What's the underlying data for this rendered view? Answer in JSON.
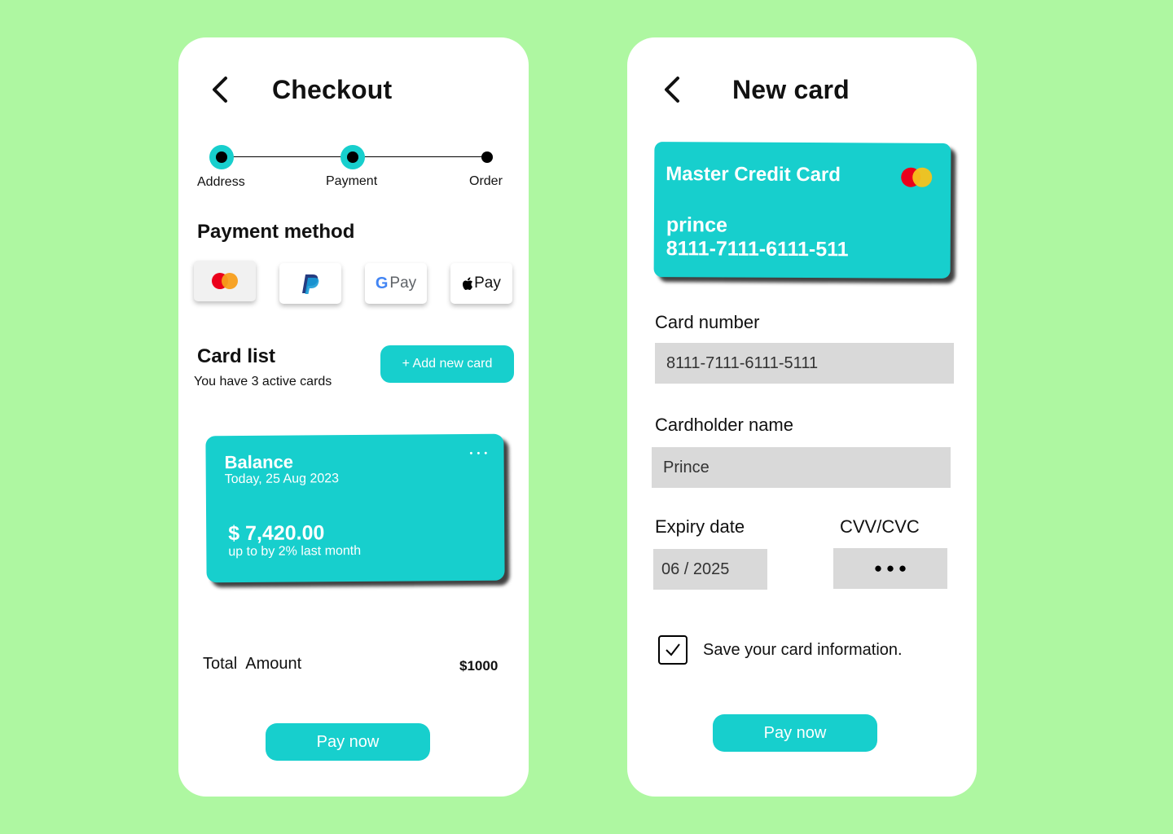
{
  "checkout": {
    "title": "Checkout",
    "steps": [
      "Address",
      "Payment",
      "Order"
    ],
    "payment_method_heading": "Payment method",
    "payment_methods": [
      {
        "name": "Mastercard",
        "icon": "mastercard-icon"
      },
      {
        "name": "PayPal",
        "icon": "paypal-icon"
      },
      {
        "name": "G Pay",
        "g": "G",
        "text": "Pay"
      },
      {
        "name": "Apple Pay",
        "apple": "",
        "text": "Pay"
      }
    ],
    "card_list_heading": "Card list",
    "card_list_sub": "You have 3 active cards",
    "add_card_label": "+ Add new card",
    "balance_card": {
      "title": "Balance",
      "date": "Today, 25 Aug 2023",
      "amount": "$ 7,420.00",
      "note": "up to by 2% last month",
      "menu": "• • •"
    },
    "total_label": "Total  Amount",
    "total_value": "$1000",
    "pay_label": "Pay now"
  },
  "new_card": {
    "title": "New card",
    "preview": {
      "type": "Master Credit Card",
      "holder": "prince",
      "number": "8111-7111-6111-511"
    },
    "card_number_label": "Card number",
    "card_number_value": "8111-7111-6111-5111",
    "holder_label": "Cardholder name",
    "holder_value": "Prince",
    "expiry_label": "Expiry date",
    "expiry_value": "06 / 2025",
    "cvv_label": "CVV/CVC",
    "cvv_value": "● ● ●",
    "save_label": "Save your card information.",
    "save_checked": true,
    "pay_label": "Pay now"
  },
  "colors": {
    "background": "#aef7a1",
    "accent": "#17cfcd",
    "field": "#d9d9d9"
  }
}
